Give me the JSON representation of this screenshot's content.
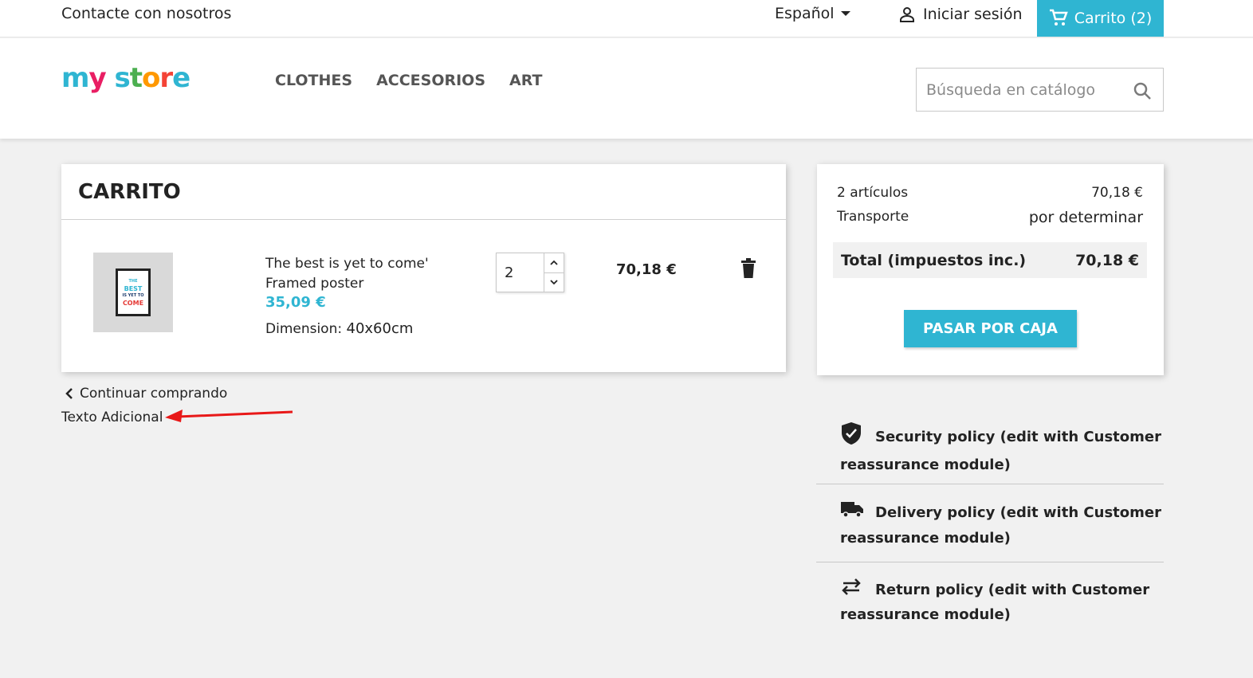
{
  "topbar": {
    "contact": "Contacte con nosotros",
    "language": "Español",
    "login": "Iniciar sesión",
    "cart": "Carrito (2)"
  },
  "header": {
    "nav": [
      "CLOTHES",
      "ACCESORIOS",
      "ART"
    ],
    "search_placeholder": "Búsqueda en catálogo"
  },
  "cart": {
    "title": "CARRITO",
    "item": {
      "name": "The best is yet to come' Framed poster",
      "unit_price": "35,09 €",
      "dimension_label": "Dimension:",
      "dimension_value": "40x60cm",
      "quantity": "2",
      "line_total": "70,18 €",
      "thumb_text": [
        "THE",
        "BEST",
        "IS YET TO",
        "COME"
      ]
    },
    "continue": "Continuar comprando",
    "extra_text": "Texto Adicional"
  },
  "summary": {
    "items_label": "2 artículos",
    "items_value": "70,18 €",
    "shipping_label": "Transporte",
    "shipping_value": "por determinar",
    "total_label": "Total (impuestos inc.)",
    "total_value": "70,18 €",
    "checkout": "PASAR POR CAJA"
  },
  "reassurance": [
    {
      "icon": "shield-check-icon",
      "text": "Security policy (edit with Customer reassurance module)"
    },
    {
      "icon": "truck-icon",
      "text": "Delivery policy (edit with Customer reassurance module)"
    },
    {
      "icon": "swap-arrows-icon",
      "text": "Return policy (edit with Customer reassurance module)"
    }
  ],
  "logo": {
    "text": "my store",
    "colors": [
      "#2fb5d2",
      "#e91e63",
      "#f44336",
      "#ff9800",
      "#4caf50"
    ]
  },
  "colors": {
    "accent": "#2fb5d2",
    "annotation_arrow": "#e81818"
  }
}
